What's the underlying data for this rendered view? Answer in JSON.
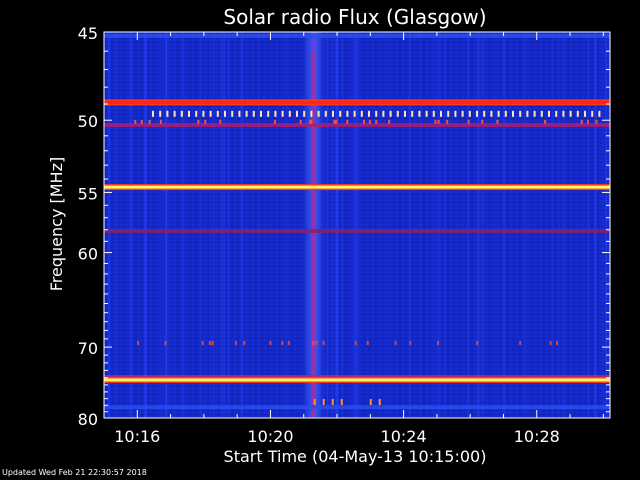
{
  "chart_data": {
    "type": "heatmap",
    "title": "Solar radio Flux (Glasgow)",
    "xlabel": "Start Time (04-May-13 10:15:00)",
    "ylabel": "Frequency [MHz]",
    "x_ticks": [
      "10:16",
      "10:20",
      "10:24",
      "10:28"
    ],
    "x_tick_minutes": [
      1,
      5,
      9,
      13
    ],
    "xlim_minutes": [
      0,
      15.2
    ],
    "y_ticks": [
      45,
      50,
      55,
      60,
      70,
      80
    ],
    "ylim": [
      45,
      80
    ],
    "y_scale": "reciprocal",
    "background_color": "#1428c8",
    "strong_bands_mhz": [
      {
        "freq": 48.9,
        "color": "#ff2020"
      },
      {
        "freq": 54.6,
        "color": "#fff36a"
      },
      {
        "freq": 74.3,
        "color": "#fff36a"
      }
    ],
    "weak_bands_mhz": [
      {
        "freq": 50.3,
        "color": "#b01c6a"
      },
      {
        "freq": 58.1,
        "color": "#8a2066"
      },
      {
        "freq": 73.9,
        "color": "#d0205a"
      },
      {
        "freq": 78.3,
        "color": "#2a4ef0"
      },
      {
        "freq": 45.2,
        "color": "#2a4ef0"
      }
    ],
    "burst_time_minutes": 6.3
  },
  "footer": "Updated Wed Feb 21 22:30:57 2018"
}
